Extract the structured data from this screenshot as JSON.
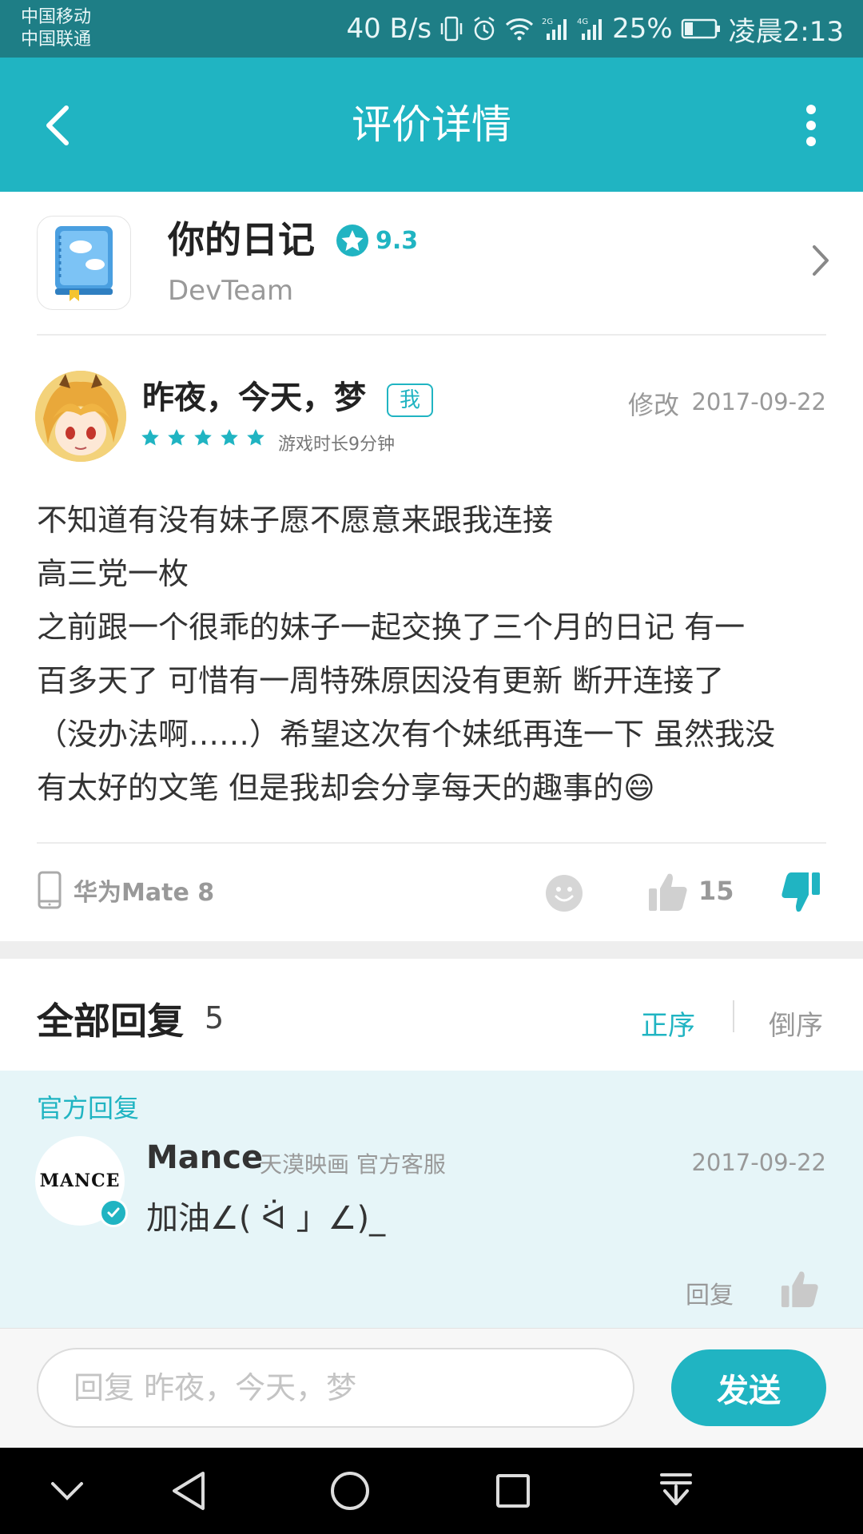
{
  "status_bar": {
    "carrier_1": "中国移动",
    "carrier_2": "中国联通",
    "net_speed": "40 B/s",
    "battery": "25%",
    "time": "凌晨2:13"
  },
  "header": {
    "title": "评价详情"
  },
  "app": {
    "name": "你的日记",
    "rating": "9.3",
    "developer": "DevTeam"
  },
  "review": {
    "author": "昨夜，今天，梦",
    "me_badge": "我",
    "edit_label": "修改",
    "date": "2017-09-22",
    "stars": 5,
    "play_time": "游戏时长9分钟",
    "lines": [
      "不知道有没有妹子愿不愿意来跟我连接",
      "高三党一枚",
      "之前跟一个很乖的妹子一起交换了三个月的日记 有一",
      "百多天了 可惜有一周特殊原因没有更新 断开连接了",
      "（没办法啊……）希望这次有个妹纸再连一下 虽然我没",
      "有太好的文笔 但是我却会分享每天的趣事的😄"
    ],
    "device": "华为Mate 8",
    "like_count": "15"
  },
  "replies": {
    "title": "全部回复",
    "count": "5",
    "sort_asc": "正序",
    "sort_desc": "倒序"
  },
  "official_reply": {
    "label": "官方回复",
    "logo_text": "MANCE",
    "author": "Mance",
    "role": "天漠映画 官方客服",
    "date": "2017-09-22",
    "text": "加油∠( ᐛ 」∠)_",
    "reply_label": "回复"
  },
  "composer": {
    "placeholder": "回复 昨夜，今天，梦",
    "send_label": "发送"
  },
  "colors": {
    "accent": "#20b4c2",
    "status_bar": "#1e7e86",
    "official_bg": "#e6f5f8"
  }
}
